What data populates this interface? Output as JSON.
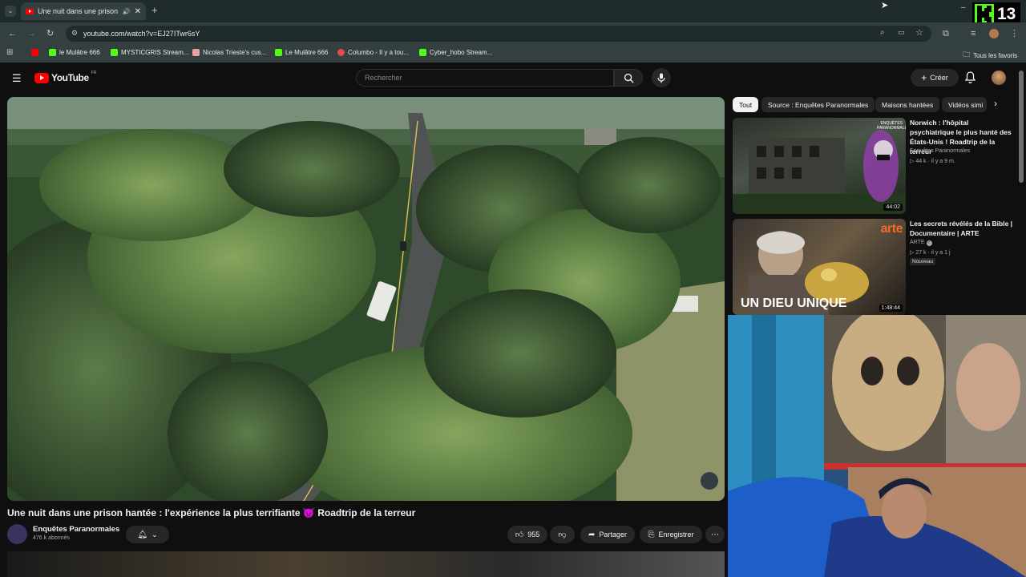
{
  "browser": {
    "tab_title": "Une nuit dans une prison h",
    "url": "youtube.com/watch?v=EJ27ITwr6sY",
    "bookmarks": [
      {
        "label": "",
        "color": "#ff0000"
      },
      {
        "label": "le Mulâtre 666",
        "color": "#53fc18"
      },
      {
        "label": "MYSTICGRIS Stream...",
        "color": "#53fc18"
      },
      {
        "label": "Nicolas Trieste's cus...",
        "color": "#e8a0a0"
      },
      {
        "label": "Le Mulâtre 666",
        "color": "#53fc18"
      },
      {
        "label": "Columbo - Il y a tou...",
        "color": "#e24c4c"
      },
      {
        "label": "Cyber_hobo Stream...",
        "color": "#53fc18"
      }
    ],
    "all_favorites": "Tous les favoris"
  },
  "youtube": {
    "logo_text": "YouTube",
    "logo_region": "FR",
    "search_placeholder": "Rechercher",
    "create_label": "Créer"
  },
  "video": {
    "title": "Une nuit dans une prison hantée : l'expérience la plus terrifiante 👿 Roadtrip de la terreur",
    "channel": "Enquêtes Paranormales",
    "subscribers": "476 k abonnés",
    "likes": "955",
    "share_label": "Partager",
    "save_label": "Enregistrer"
  },
  "chips": [
    "Tout",
    "Source : Enquêtes Paranormales",
    "Maisons hantées",
    "Vidéos simi"
  ],
  "recommendations": [
    {
      "title": "Norwich : l'hôpital psychiatrique le plus hanté des États-Unis ! Roadtrip de la terreur",
      "channel": "Enquêtes Paranormales",
      "meta": "44 k · il y a 9 m.",
      "duration": "44:02",
      "thumb_badge": "ENQUÊTES PARANORMALES"
    },
    {
      "title": "Les secrets révélés de la Bible | Documentaire | ARTE",
      "channel": "ARTE",
      "meta": "27 k · il y a 1 j",
      "badge": "Nouveau",
      "duration": "1:48:44",
      "thumb_text": "UN DIEU UNIQUE",
      "thumb_logo": "arte"
    }
  ],
  "overlay": {
    "kick_count": "13"
  }
}
